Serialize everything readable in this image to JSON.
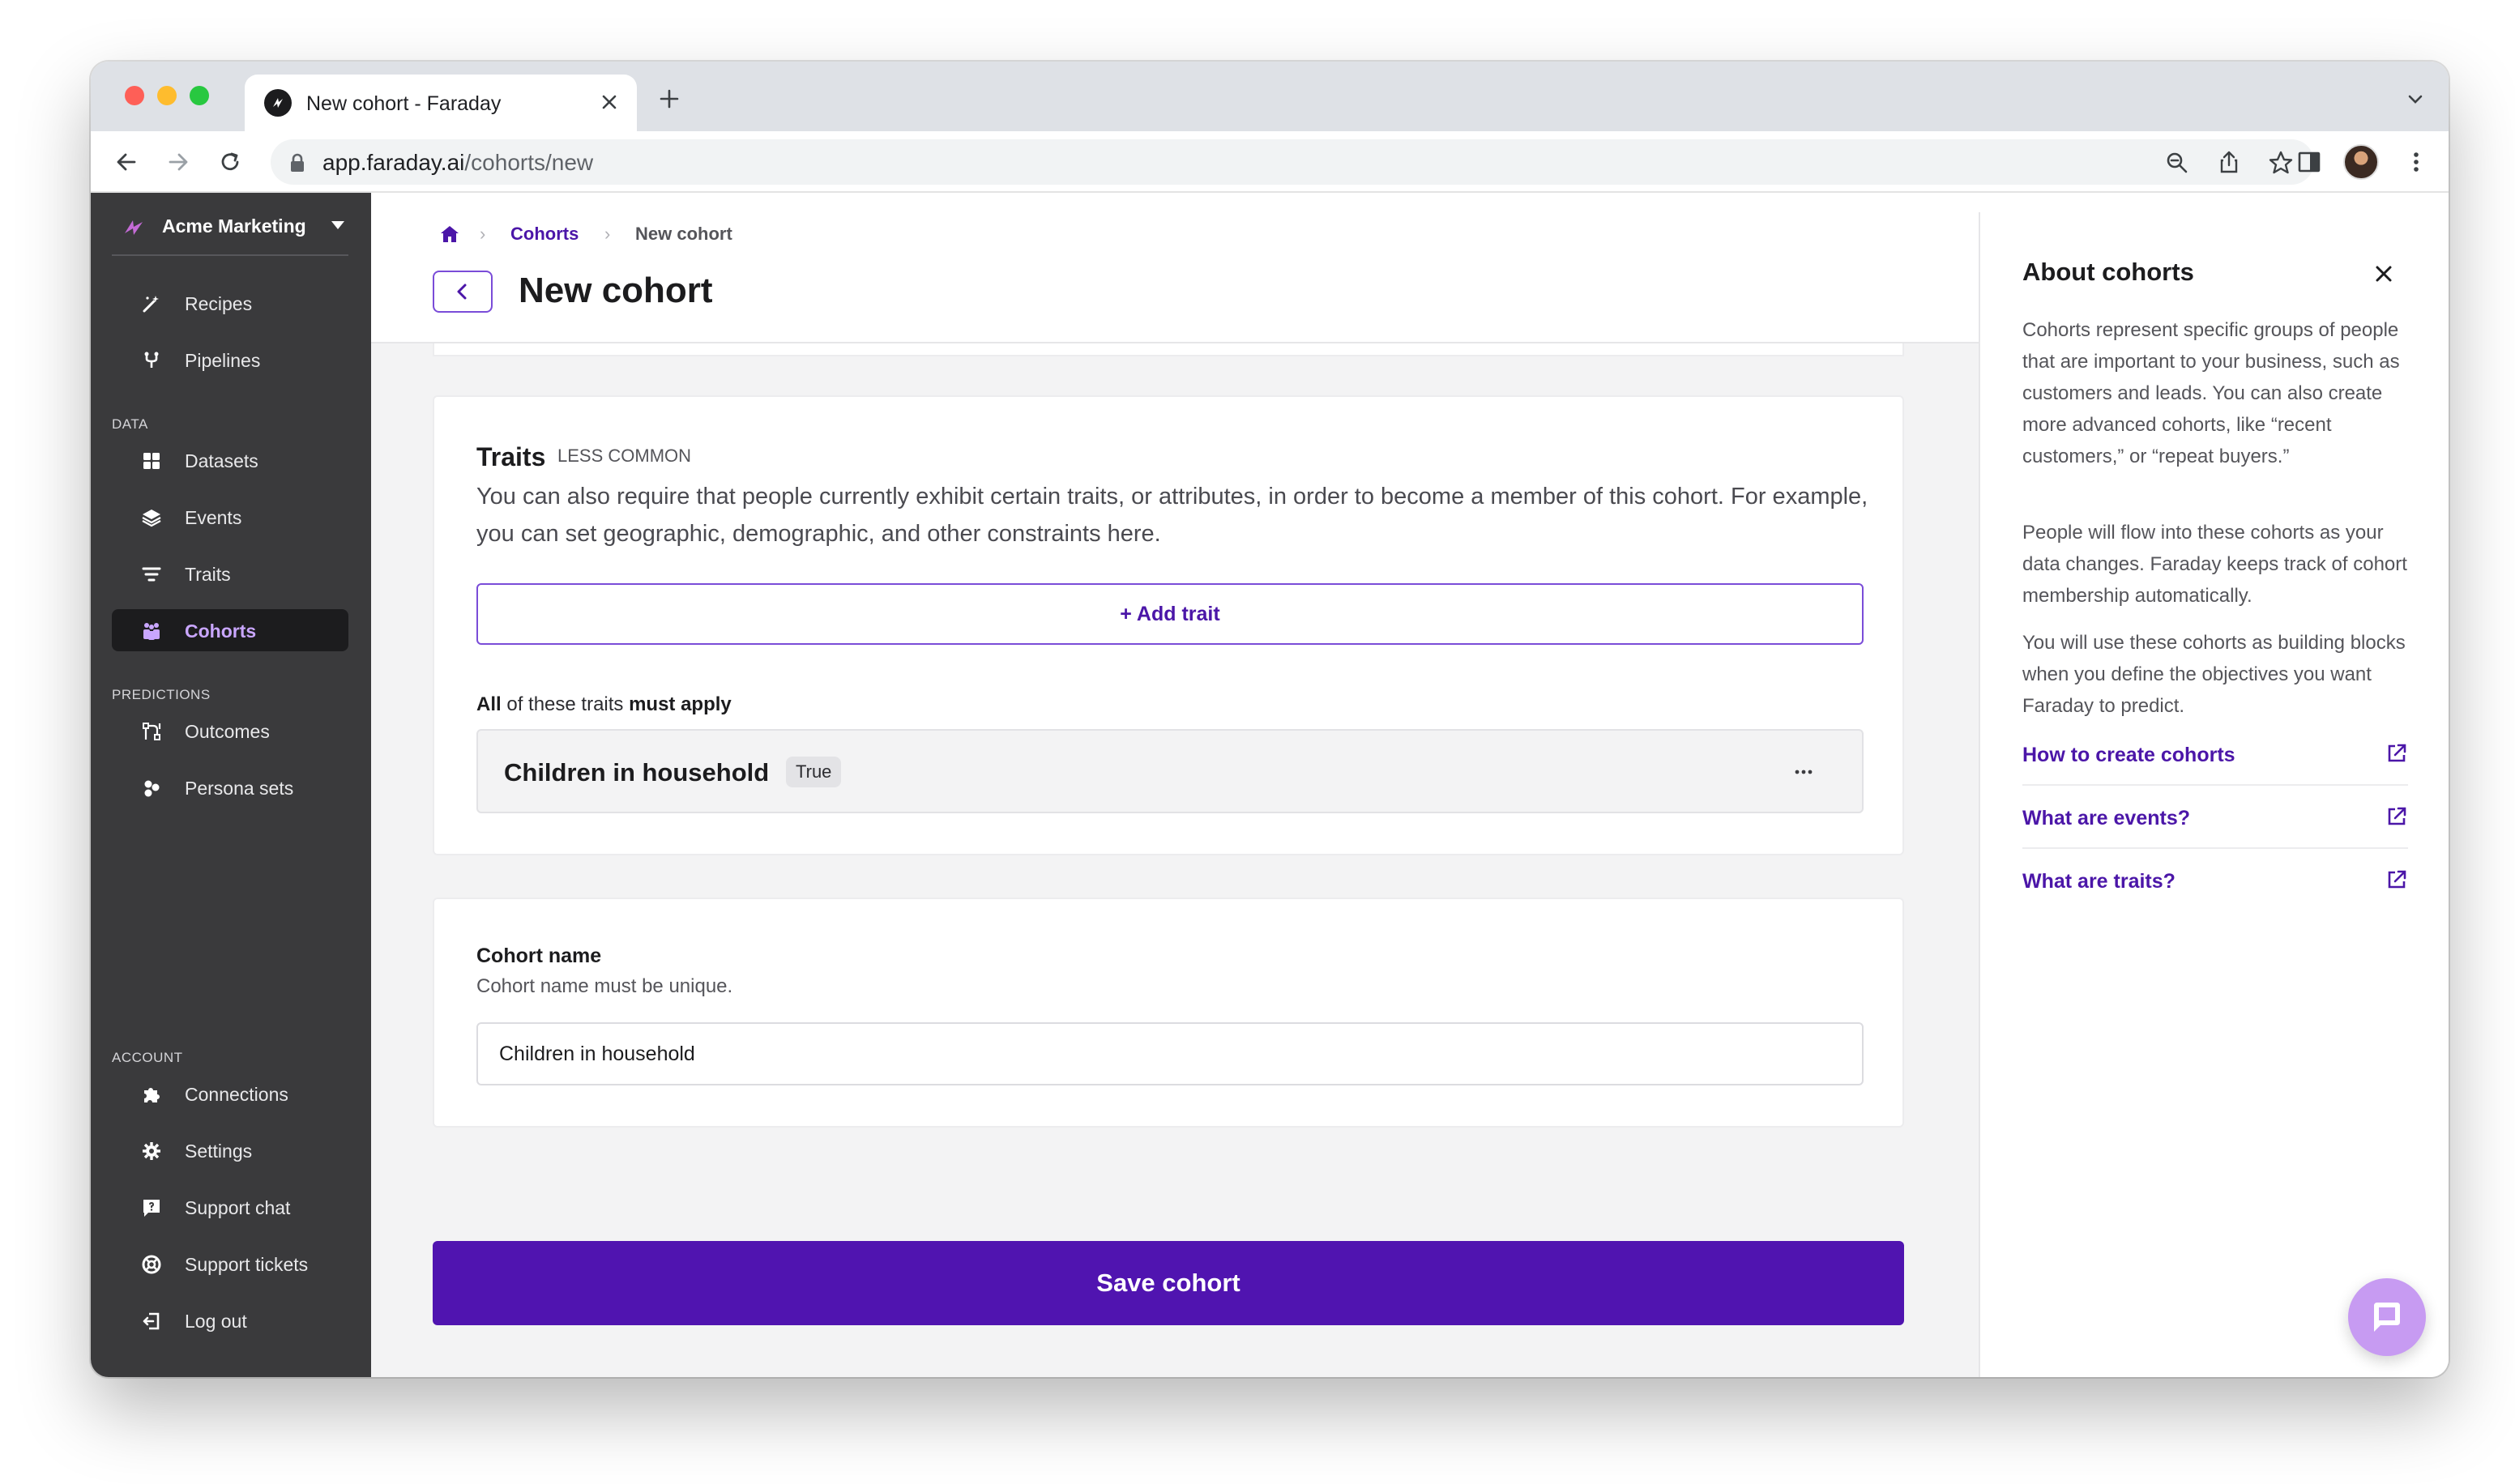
{
  "browser": {
    "tab_title": "New cohort - Faraday",
    "url_host": "app.faraday.ai",
    "url_path": "/cohorts/new"
  },
  "colors": {
    "brand_purple": "#5014b0",
    "link_purple": "#4b16a8",
    "sidebar_bg": "#3a3a3c",
    "active_item_bg": "#1c1c1e"
  },
  "sidebar": {
    "workspace": "Acme Marketing",
    "top_items": [
      {
        "label": "Recipes",
        "icon": "magic-wand-icon"
      },
      {
        "label": "Pipelines",
        "icon": "pipeline-icon"
      }
    ],
    "data_label": "DATA",
    "data_items": [
      {
        "label": "Datasets",
        "icon": "grid-icon"
      },
      {
        "label": "Events",
        "icon": "layers-icon"
      },
      {
        "label": "Traits",
        "icon": "filter-icon"
      },
      {
        "label": "Cohorts",
        "icon": "people-icon",
        "active": true
      }
    ],
    "predictions_label": "PREDICTIONS",
    "prediction_items": [
      {
        "label": "Outcomes",
        "icon": "outcomes-icon"
      },
      {
        "label": "Persona sets",
        "icon": "persona-icon"
      }
    ],
    "account_label": "ACCOUNT",
    "account_items": [
      {
        "label": "Connections",
        "icon": "puzzle-icon"
      },
      {
        "label": "Settings",
        "icon": "gear-icon"
      },
      {
        "label": "Support chat",
        "icon": "chat-icon"
      },
      {
        "label": "Support tickets",
        "icon": "lifebuoy-icon"
      },
      {
        "label": "Log out",
        "icon": "logout-icon"
      }
    ]
  },
  "header": {
    "breadcrumb": {
      "parent": "Cohorts",
      "current": "New cohort"
    },
    "title": "New cohort"
  },
  "traits_card": {
    "title": "Traits",
    "tag": "LESS COMMON",
    "description": "You can also require that people currently exhibit certain traits, or attributes, in order to become a member of this cohort. For example, you can set geographic, demographic, and other constraints here.",
    "add_label": "Add trait",
    "apply_all": "All",
    "apply_middle": " of these traits ",
    "apply_must": "must apply",
    "trait": {
      "name": "Children in household",
      "value": "True"
    }
  },
  "name_card": {
    "label": "Cohort name",
    "help": "Cohort name must be unique.",
    "value": "Children in household"
  },
  "save_label": "Save cohort",
  "panel": {
    "title": "About cohorts",
    "paragraphs": [
      "Cohorts represent specific groups of people that are important to your business, such as customers and leads. You can also create more advanced cohorts, like “recent customers,” or “repeat buyers.”",
      "People will flow into these cohorts as your data changes. Faraday keeps track of cohort membership automatically.",
      "You will use these cohorts as building blocks when you define the objectives you want Faraday to predict."
    ],
    "links": [
      "How to create cohorts",
      "What are events?",
      "What are traits?"
    ]
  }
}
